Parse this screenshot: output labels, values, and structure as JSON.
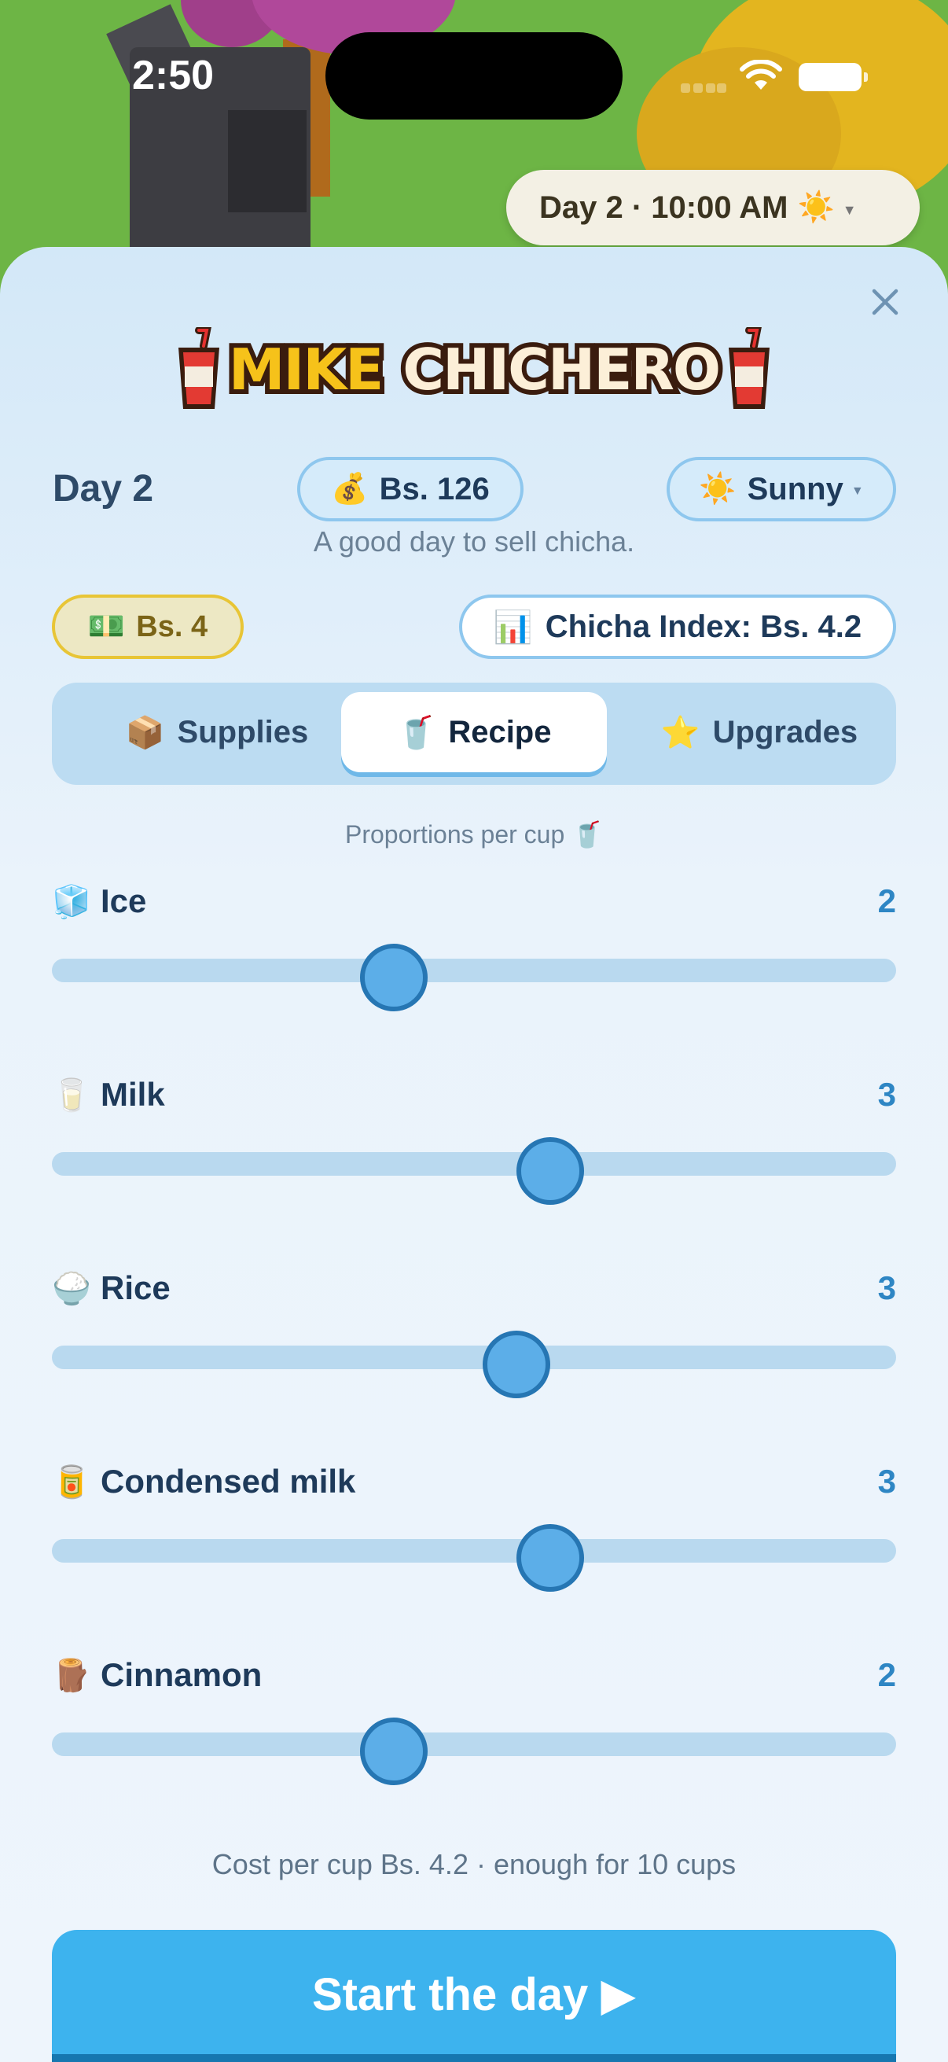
{
  "status_bar": {
    "time": "2:50"
  },
  "clock": {
    "label": "Day 2 · 10:00 AM",
    "icon": "sun-icon"
  },
  "title": {
    "word1": "MIKE",
    "word2": "CHICHERO"
  },
  "header": {
    "day": "Day 2",
    "money": "Bs. 126",
    "weather": "Sunny",
    "tagline": "A good day to sell chicha.",
    "cash": "Bs. 4",
    "index": "Chicha Index: Bs. 4.2"
  },
  "tabs": [
    {
      "label": "Supplies",
      "icon": "📦",
      "selected": false
    },
    {
      "label": "Recipe",
      "icon": "🥤",
      "selected": true
    },
    {
      "label": "Upgrades",
      "icon": "⭐",
      "selected": false
    }
  ],
  "recipe": {
    "subtitle": "Proportions per cup 🥤",
    "ingredients": [
      {
        "name": "Ice",
        "icon": "🧊",
        "value": "2",
        "fraction": 0.405
      },
      {
        "name": "Milk",
        "icon": "🥛",
        "value": "3",
        "fraction": 0.59
      },
      {
        "name": "Rice",
        "icon": "🍚",
        "value": "3",
        "fraction": 0.55
      },
      {
        "name": "Condensed milk",
        "icon": "🥫",
        "value": "3",
        "fraction": 0.59
      },
      {
        "name": "Cinnamon",
        "icon": "🪵",
        "value": "2",
        "fraction": 0.405
      }
    ],
    "cost_text": "Cost per cup Bs. 4.2 · enough for 10 cups"
  },
  "start_button": "Start the day ▶",
  "colors": {
    "accent": "#3db3ee",
    "thumb": "#5caee8",
    "track": "#b9d9ef",
    "cash_border": "#e8c536"
  }
}
